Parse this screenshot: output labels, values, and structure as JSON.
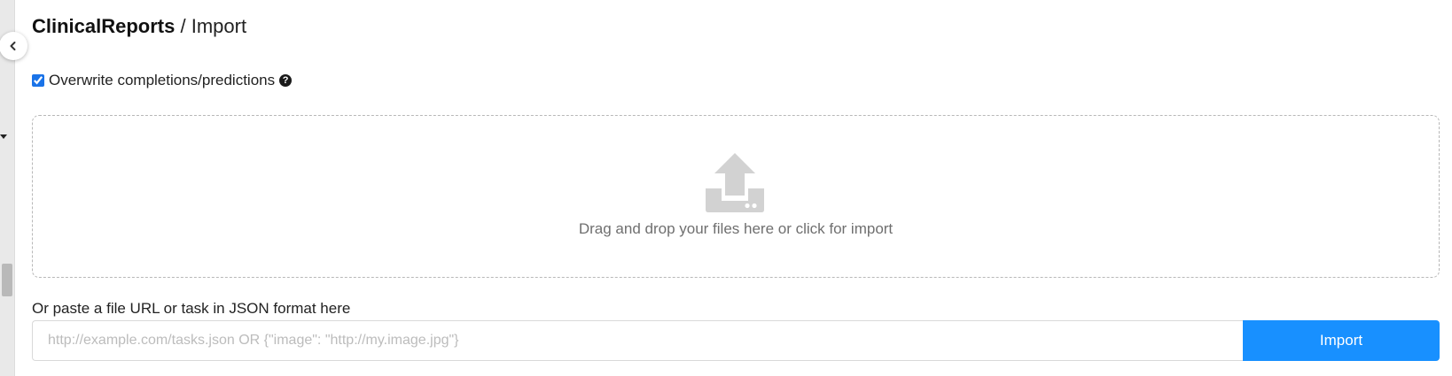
{
  "sidebar": {
    "collapse_icon": "chevron-left-icon"
  },
  "header": {
    "project": "ClinicalReports",
    "separator": " / ",
    "page": "Import"
  },
  "options": {
    "overwrite_label": "Overwrite completions/predictions",
    "overwrite_checked": true,
    "help_icon": "question-circle-icon",
    "help_glyph": "?"
  },
  "dropzone": {
    "icon": "upload-icon",
    "text": "Drag and drop your files here or click for import"
  },
  "paste": {
    "label": "Or paste a file URL or task in JSON format here",
    "value": "",
    "placeholder": "http://example.com/tasks.json OR {\"image\": \"http://my.image.jpg\"}",
    "button_label": "Import"
  },
  "colors": {
    "accent": "#1890ff",
    "icon_gray": "#d2d2d2",
    "border_dashed": "#b8b8b8"
  }
}
